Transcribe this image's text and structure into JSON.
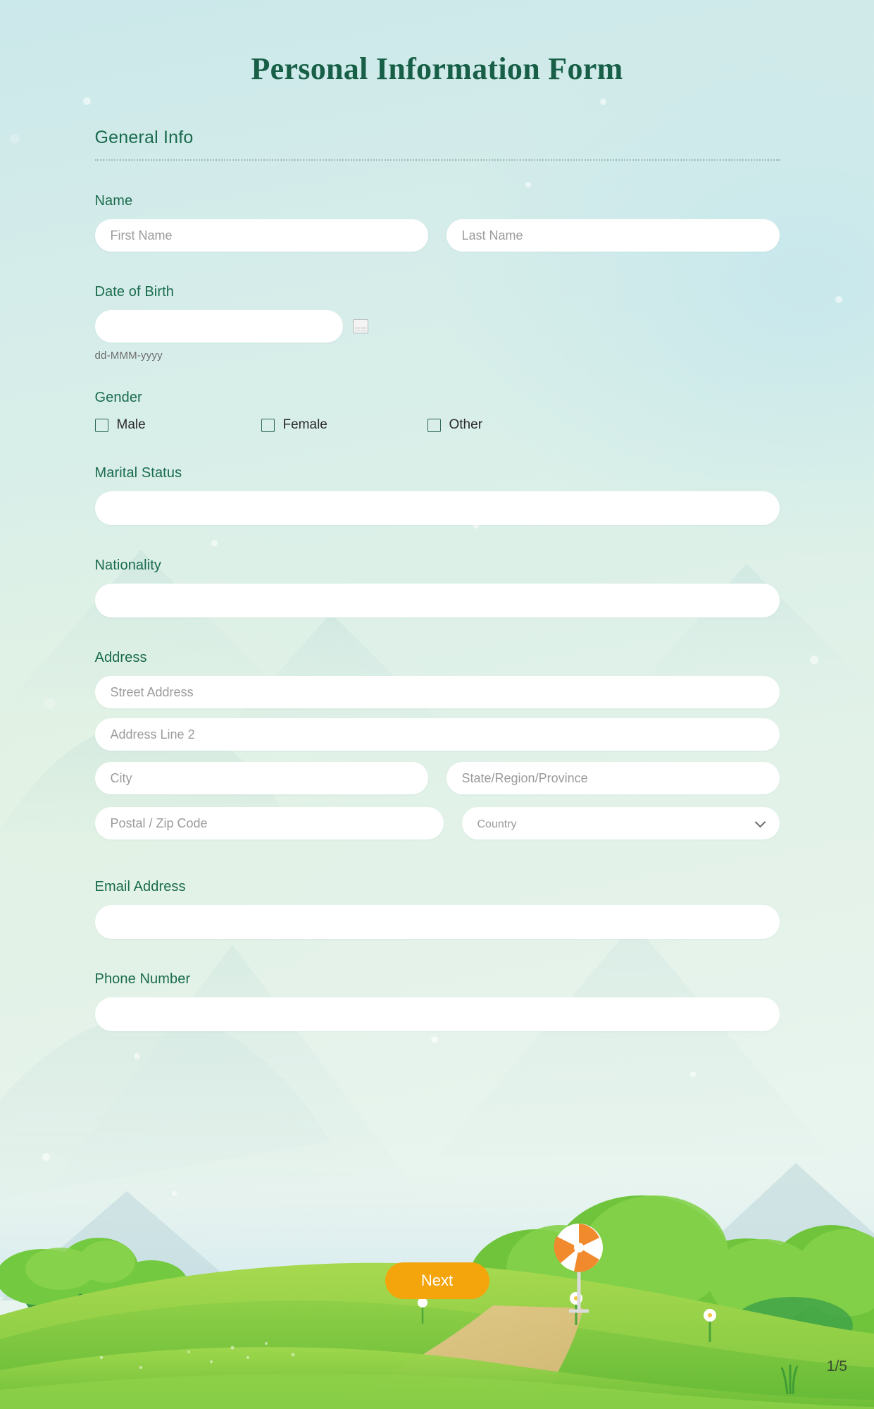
{
  "page": {
    "title": "Personal Information Form",
    "accent_green": "#176047",
    "label_green": "#1a6b4d",
    "next_button_orange": "#f5a50c",
    "background_top": "#cbe8ea",
    "background_bottom": "#eaf5f2"
  },
  "section": {
    "heading": "General Info"
  },
  "fields": {
    "name": {
      "label": "Name",
      "first_placeholder": "First Name",
      "last_placeholder": "Last Name",
      "first_value": "",
      "last_value": ""
    },
    "dob": {
      "label": "Date of Birth",
      "value": "",
      "placeholder": "",
      "hint": "dd-MMM-yyyy",
      "icon": "calendar-icon"
    },
    "gender": {
      "label": "Gender",
      "options": [
        {
          "label": "Male",
          "checked": false
        },
        {
          "label": "Female",
          "checked": false
        },
        {
          "label": "Other",
          "checked": false
        }
      ]
    },
    "marital_status": {
      "label": "Marital Status",
      "value": "",
      "placeholder": ""
    },
    "nationality": {
      "label": "Nationality",
      "value": "",
      "placeholder": ""
    },
    "address": {
      "label": "Address",
      "street_placeholder": "Street Address",
      "line2_placeholder": "Address Line 2",
      "city_placeholder": "City",
      "state_placeholder": "State/Region/Province",
      "postal_placeholder": "Postal / Zip Code",
      "country_placeholder": "Country",
      "country_icon": "chevron-down-icon",
      "street_value": "",
      "line2_value": "",
      "city_value": "",
      "state_value": "",
      "postal_value": "",
      "country_value": ""
    },
    "email": {
      "label": "Email Address",
      "value": "",
      "placeholder": ""
    },
    "phone": {
      "label": "Phone Number",
      "value": "",
      "placeholder": ""
    }
  },
  "footer": {
    "next_label": "Next",
    "page_indicator": "1/5"
  }
}
